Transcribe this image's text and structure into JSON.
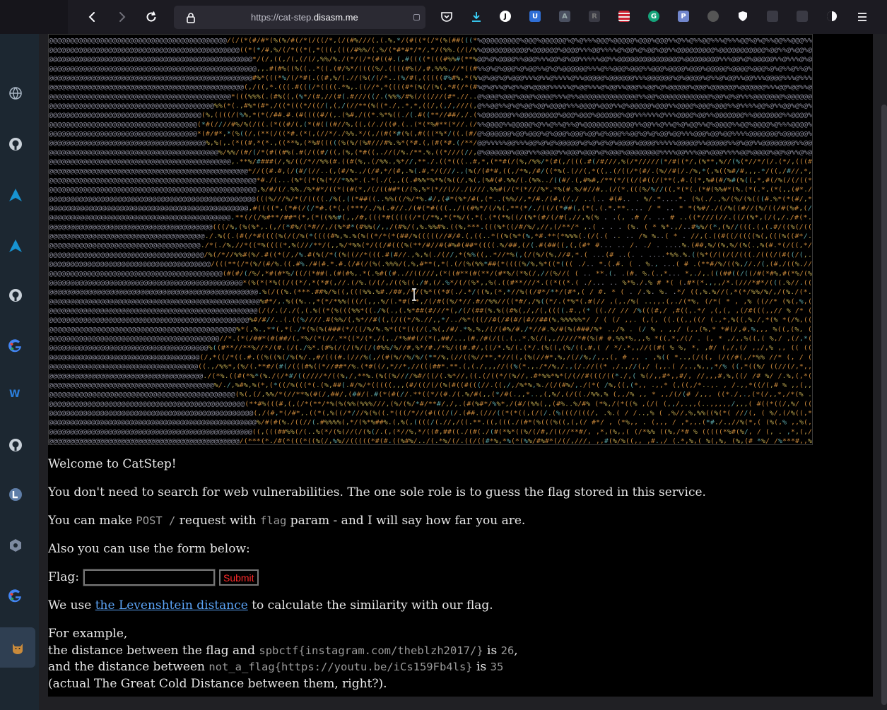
{
  "browser": {
    "url_prefix": "https://cat-step.",
    "url_domain": "disasm.me",
    "toolbar_icons": [
      "back-icon",
      "forward-icon",
      "reload-icon",
      "lock-icon",
      "pocket-icon",
      "downloads-icon",
      "extension-j-icon",
      "bitwarden-icon",
      "extension-a-icon",
      "extension-reader-icon",
      "flag-extension-icon",
      "grammarly-icon",
      "extension-p-icon",
      "globe-extension-icon",
      "shield-extension-icon",
      "extension-grey-icon",
      "extension-grid-icon",
      "dark-reader-icon",
      "menu-icon"
    ]
  },
  "sidebar": {
    "items": [
      {
        "name": "sidebar-globe",
        "icon": "globe-icon"
      },
      {
        "name": "sidebar-github-1",
        "icon": "github-icon"
      },
      {
        "name": "sidebar-arch-1",
        "icon": "arch-icon"
      },
      {
        "name": "sidebar-arch-2",
        "icon": "arch-icon"
      },
      {
        "name": "sidebar-github-2",
        "icon": "github-icon"
      },
      {
        "name": "sidebar-google-1",
        "icon": "google-icon"
      },
      {
        "name": "sidebar-wm",
        "icon": "wm-icon"
      },
      {
        "name": "sidebar-github-3",
        "icon": "github-icon"
      },
      {
        "name": "sidebar-l",
        "icon": "l-circle-icon"
      },
      {
        "name": "sidebar-hex",
        "icon": "hexagon-icon"
      },
      {
        "name": "sidebar-google-2",
        "icon": "google-icon"
      },
      {
        "name": "sidebar-cat",
        "icon": "cat-icon"
      }
    ]
  },
  "page": {
    "welcome": "Welcome to CatStep!",
    "intro": "You don't need to search for web vulnerabilities. The one sole role is to guess the flag stored in this service.",
    "post_pre": "You can make ",
    "post_code": "POST /",
    "post_mid": " request with ",
    "post_param": "flag",
    "post_post": " param - and I will say how far you are.",
    "form_intro": "Also you can use the form below:",
    "flag_label": "Flag:",
    "flag_value": "",
    "submit_label": "Submit",
    "lev_pre": "We use ",
    "lev_link": "the Levenshtein distance",
    "lev_post": " to calculate the similarity with our flag.",
    "example_intro": "For example,",
    "ex1_pre": "the distance between the flag and ",
    "ex1_flag": "spbctf{instagram.com/theblzh2017/}",
    "ex1_mid": " is ",
    "ex1_value": "26",
    "ex1_post": ",",
    "ex2_pre": "and the distance between ",
    "ex2_flag": "not_a_flag{https://youtu.be/iCs159Fb4ls}",
    "ex2_mid": " is ",
    "ex2_value": "35",
    "ex3": "(actual The Great Cold Distance between them, right?)."
  },
  "colors": {
    "ascii_at": "#8a8a9a",
    "ascii_amber": "#c8873a",
    "ascii_yellow": "#b7a24d",
    "ascii_teal": "#5aa3a5",
    "link": "#5ba3f5",
    "submit_text": "#ff2a2a"
  }
}
